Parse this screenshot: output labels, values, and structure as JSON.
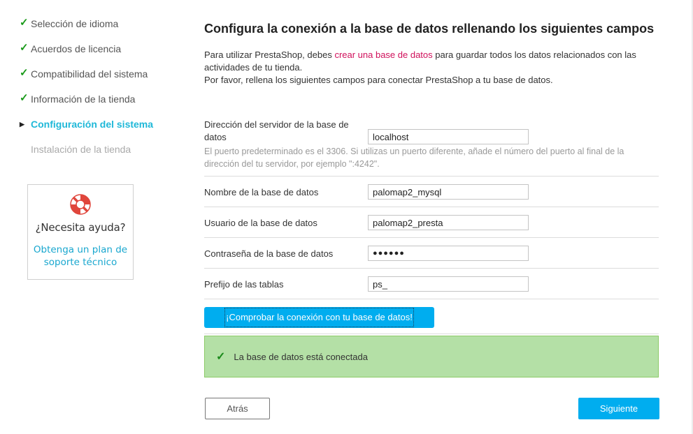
{
  "sidebar": {
    "steps": [
      {
        "label": "Selección de idioma",
        "mark": "✓"
      },
      {
        "label": "Acuerdos de licencia",
        "mark": "✓"
      },
      {
        "label": "Compatibilidad del sistema",
        "mark": "✓"
      },
      {
        "label": "Información de la tienda",
        "mark": "✓"
      },
      {
        "label": "Configuración del sistema",
        "mark": "▶"
      },
      {
        "label": "Instalación de la tienda",
        "mark": ""
      }
    ],
    "help": {
      "icon": "lifebuoy-icon",
      "title": "¿Necesita ayuda?",
      "link": "Obtenga un plan de soporte técnico"
    }
  },
  "main": {
    "heading": "Configura la conexión a la base de datos rellenando los siguientes campos",
    "intro": {
      "before_link": "Para utilizar PrestaShop, debes ",
      "link": "crear una base de datos",
      "after_link": " para guardar todos los datos relacionados con las actividades de tu tienda.",
      "line2": "Por favor, rellena los siguientes campos para conectar PrestaShop a tu base de datos."
    },
    "fields": {
      "server": {
        "label": "Dirección del servidor de la base de datos",
        "value": "localhost",
        "hint": "El puerto predeterminado es el 3306. Si utilizas un puerto diferente, añade el número del puerto al final de la dirección del tu servidor, por ejemplo \":4242\"."
      },
      "dbname": {
        "label": "Nombre de la base de datos",
        "value": "palomap2_mysql"
      },
      "user": {
        "label": "Usuario de la base de datos",
        "value": "palomap2_presta"
      },
      "password": {
        "label": "Contraseña de la base de datos",
        "value": "●●●●●●"
      },
      "prefix": {
        "label": "Prefijo de las tablas",
        "value": "ps_"
      }
    },
    "check_button": "¡Comprobar la conexión con tu base de datos!",
    "success_message": "La base de datos está conectada",
    "success_mark": "✓",
    "back_button": "Atrás",
    "next_button": "Siguiente"
  },
  "colors": {
    "accent": "#00adef",
    "active_step": "#1fb8d8",
    "link": "#d0105b",
    "success_bg": "#b4e0a6",
    "check": "#1a9a1a"
  }
}
